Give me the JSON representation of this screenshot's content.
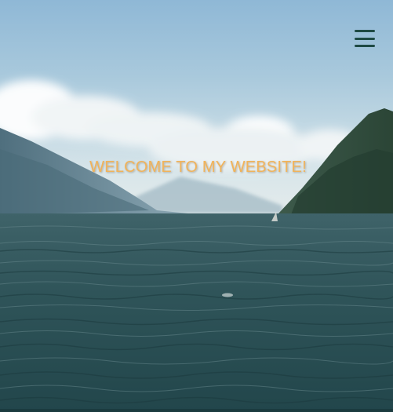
{
  "hero": {
    "title": "WELCOME TO MY WEBSITE!",
    "title_color": "#f1b35a"
  },
  "nav": {
    "menu_icon": "hamburger-menu-icon",
    "menu_icon_color": "#1e4a44"
  },
  "background": {
    "sky_color": "#a9c9dc",
    "water_color": "#2d5055",
    "mountain_color": "#2f4a3d"
  }
}
